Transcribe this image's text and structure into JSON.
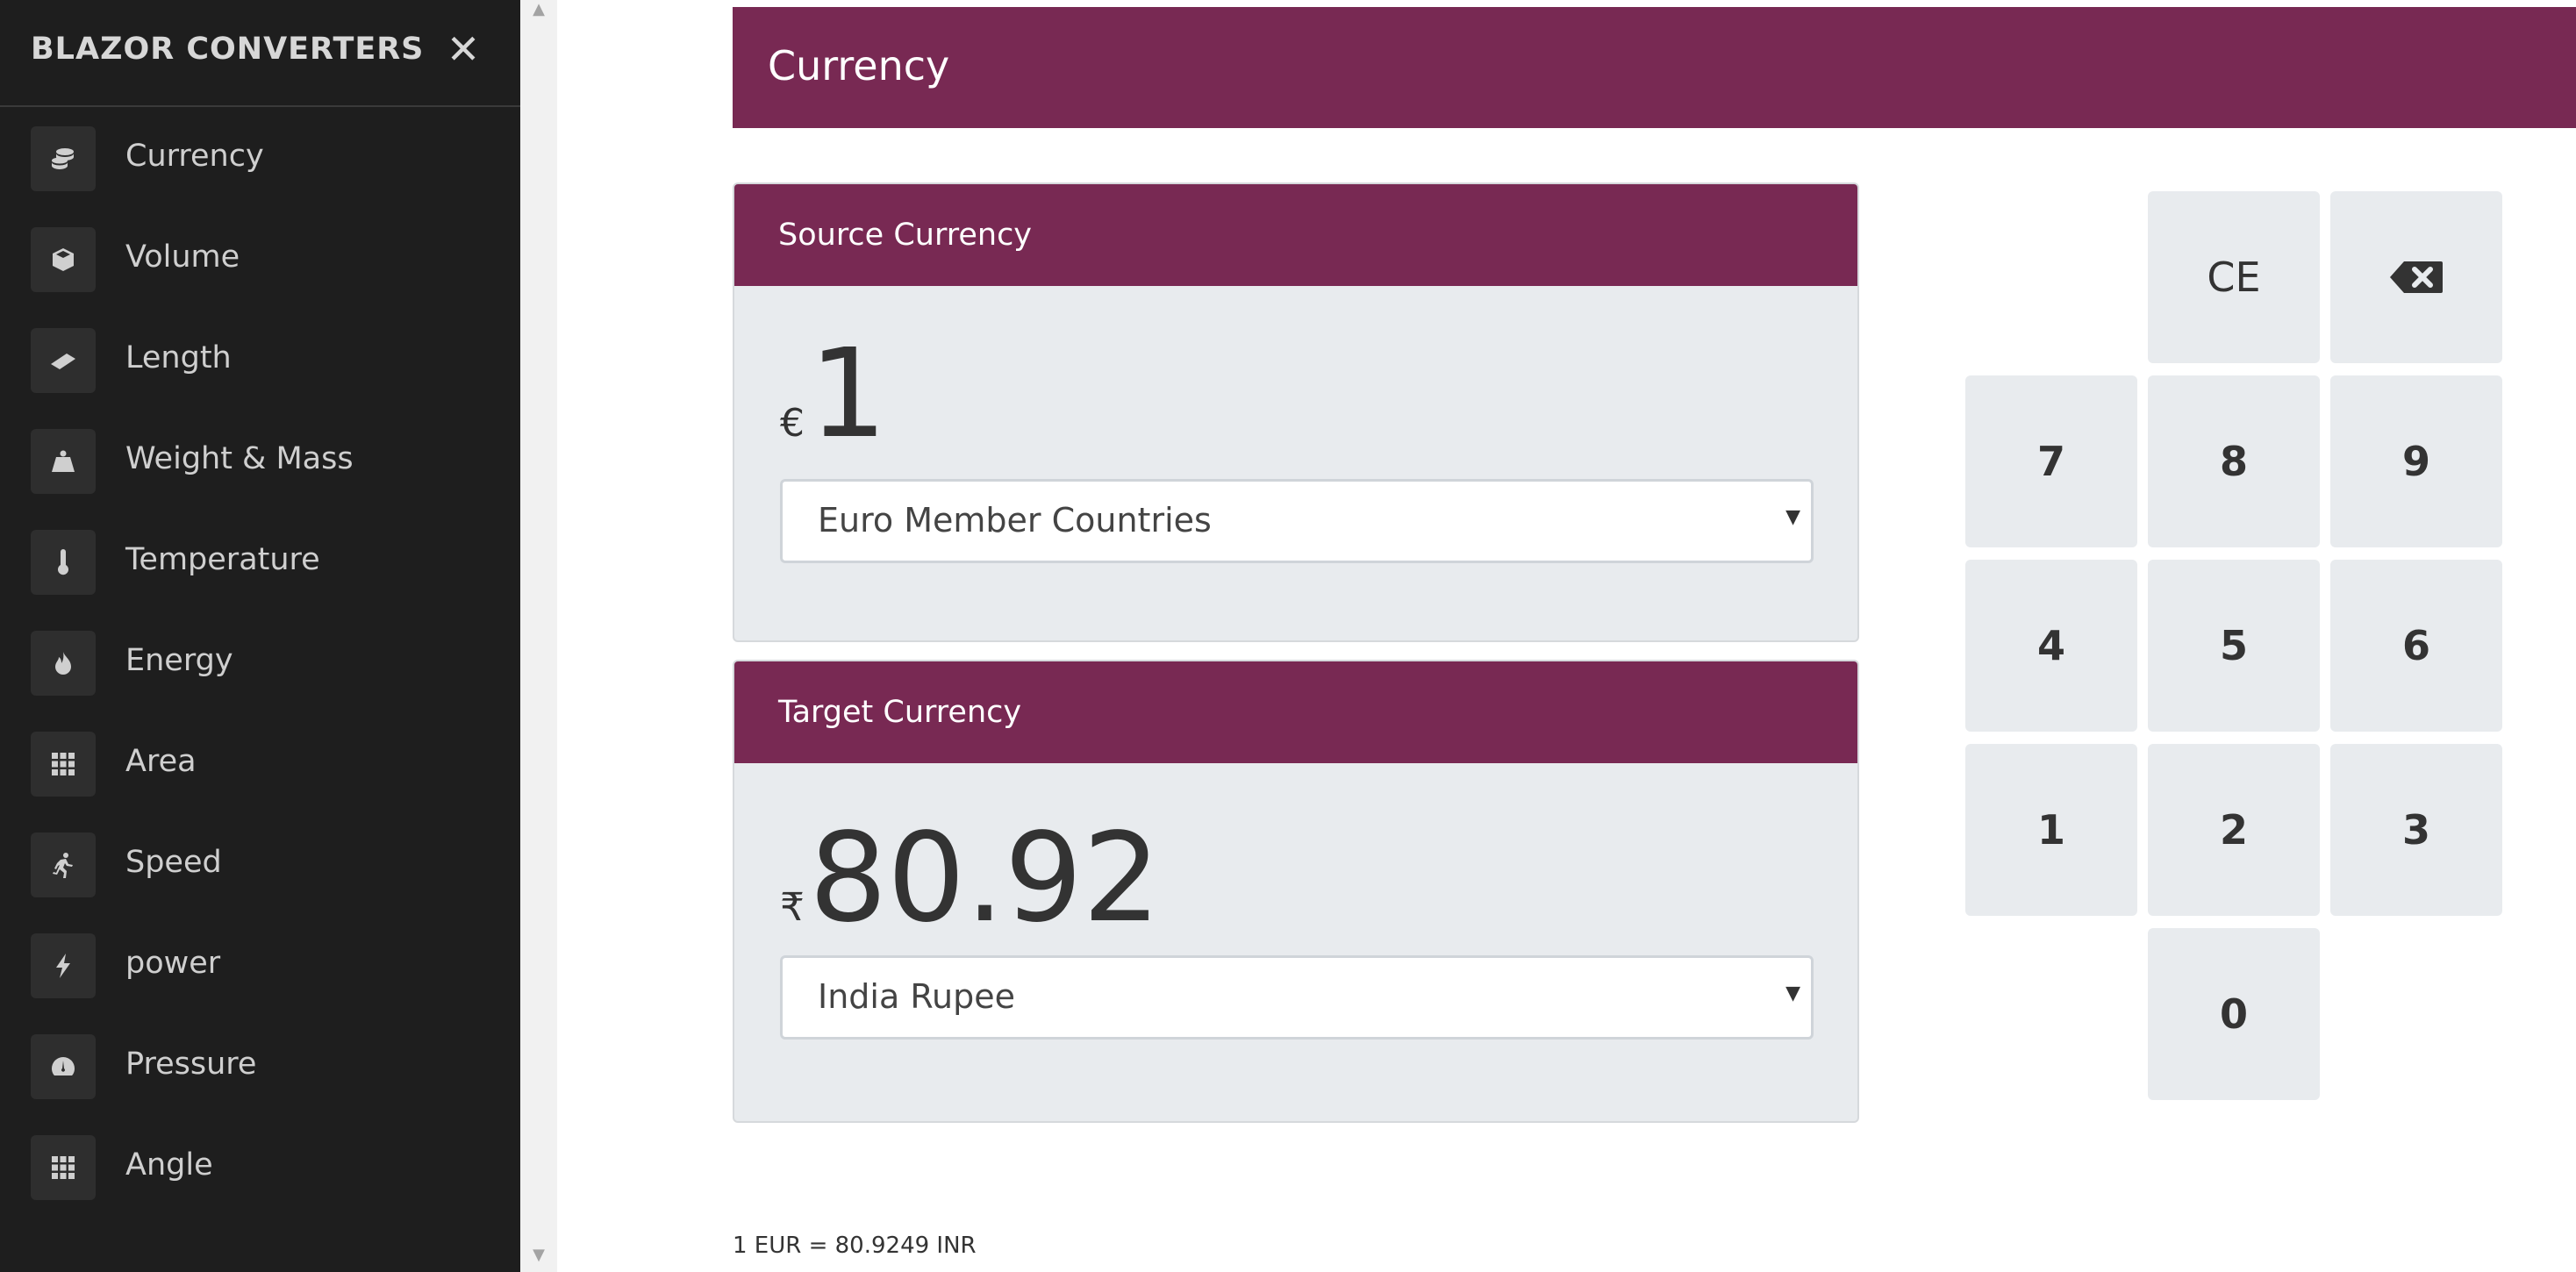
{
  "sidebar": {
    "brand": "BLAZOR CONVERTERS",
    "close_icon": "close-icon",
    "items": [
      {
        "label": "Currency",
        "icon": "coins-icon"
      },
      {
        "label": "Volume",
        "icon": "cube-icon"
      },
      {
        "label": "Length",
        "icon": "ruler-icon"
      },
      {
        "label": "Weight & Mass",
        "icon": "weight-icon"
      },
      {
        "label": "Temperature",
        "icon": "thermometer-icon"
      },
      {
        "label": "Energy",
        "icon": "flame-icon"
      },
      {
        "label": "Area",
        "icon": "grid-icon"
      },
      {
        "label": "Speed",
        "icon": "running-icon"
      },
      {
        "label": "power",
        "icon": "bolt-icon"
      },
      {
        "label": "Pressure",
        "icon": "gauge-icon"
      },
      {
        "label": "Angle",
        "icon": "grid-icon"
      }
    ]
  },
  "header": {
    "title": "Currency"
  },
  "source": {
    "title": "Source Currency",
    "symbol": "€",
    "amount": "1",
    "selected": "Euro Member Countries"
  },
  "target": {
    "title": "Target Currency",
    "symbol": "₹",
    "amount": "80.92",
    "selected": "India Rupee"
  },
  "keypad": {
    "ce": "CE",
    "backspace_icon": "backspace-icon",
    "k7": "7",
    "k8": "8",
    "k9": "9",
    "k4": "4",
    "k5": "5",
    "k6": "6",
    "k1": "1",
    "k2": "2",
    "k3": "3",
    "k0": "0"
  },
  "rate_text": "1 EUR = 80.9249 INR",
  "colors": {
    "accent": "#782953",
    "sidebar": "#1e1e1e",
    "card": "#e8ebee"
  }
}
